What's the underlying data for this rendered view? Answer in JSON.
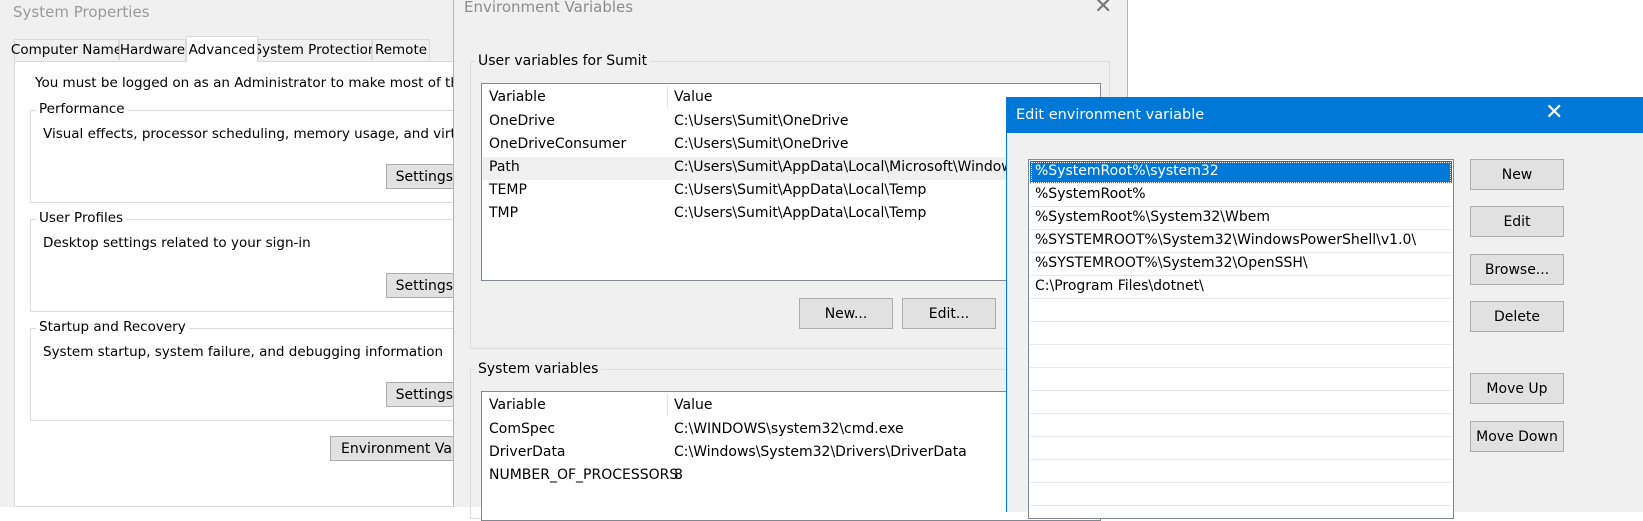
{
  "system_properties": {
    "title": "System Properties",
    "tabs": [
      {
        "label": "Computer Name"
      },
      {
        "label": "Hardware"
      },
      {
        "label": "Advanced"
      },
      {
        "label": "System Protection"
      },
      {
        "label": "Remote"
      }
    ],
    "admin_note": "You must be logged on as an Administrator to make most of these changes.",
    "performance": {
      "title": "Performance",
      "description": "Visual effects, processor scheduling, memory usage, and virtual memory",
      "settings_label": "Settings..."
    },
    "user_profiles": {
      "title": "User Profiles",
      "description": "Desktop settings related to your sign-in",
      "settings_label": "Settings..."
    },
    "startup_recovery": {
      "title": "Startup and Recovery",
      "description": "System startup, system failure, and debugging information",
      "settings_label": "Settings..."
    },
    "env_button_label": "Environment Variables..."
  },
  "environment_variables": {
    "title": "Environment Variables",
    "close_glyph": "✕",
    "user_group_title": "User variables for Sumit",
    "user_headers": {
      "variable": "Variable",
      "value": "Value"
    },
    "user_rows": [
      {
        "variable": "OneDrive",
        "value": "C:\\Users\\Sumit\\OneDrive"
      },
      {
        "variable": "OneDriveConsumer",
        "value": "C:\\Users\\Sumit\\OneDrive"
      },
      {
        "variable": "Path",
        "value": "C:\\Users\\Sumit\\AppData\\Local\\Microsoft\\WindowsApps;"
      },
      {
        "variable": "TEMP",
        "value": "C:\\Users\\Sumit\\AppData\\Local\\Temp"
      },
      {
        "variable": "TMP",
        "value": "C:\\Users\\Sumit\\AppData\\Local\\Temp"
      }
    ],
    "new_label": "New...",
    "edit_label": "Edit...",
    "system_group_title": "System variables",
    "system_headers": {
      "variable": "Variable",
      "value": "Value"
    },
    "system_rows": [
      {
        "variable": "ComSpec",
        "value": "C:\\WINDOWS\\system32\\cmd.exe"
      },
      {
        "variable": "DriverData",
        "value": "C:\\Windows\\System32\\Drivers\\DriverData"
      },
      {
        "variable": "NUMBER_OF_PROCESSORS",
        "value": "8"
      }
    ]
  },
  "edit_env": {
    "title": "Edit environment variable",
    "close_glyph": "✕",
    "entries": [
      "%SystemRoot%\\system32",
      "%SystemRoot%",
      "%SystemRoot%\\System32\\Wbem",
      "%SYSTEMROOT%\\System32\\WindowsPowerShell\\v1.0\\",
      "%SYSTEMROOT%\\System32\\OpenSSH\\",
      "C:\\Program Files\\dotnet\\"
    ],
    "buttons": {
      "new": "New",
      "edit": "Edit",
      "browse": "Browse...",
      "delete": "Delete",
      "move_up": "Move Up",
      "move_down": "Move Down"
    }
  }
}
